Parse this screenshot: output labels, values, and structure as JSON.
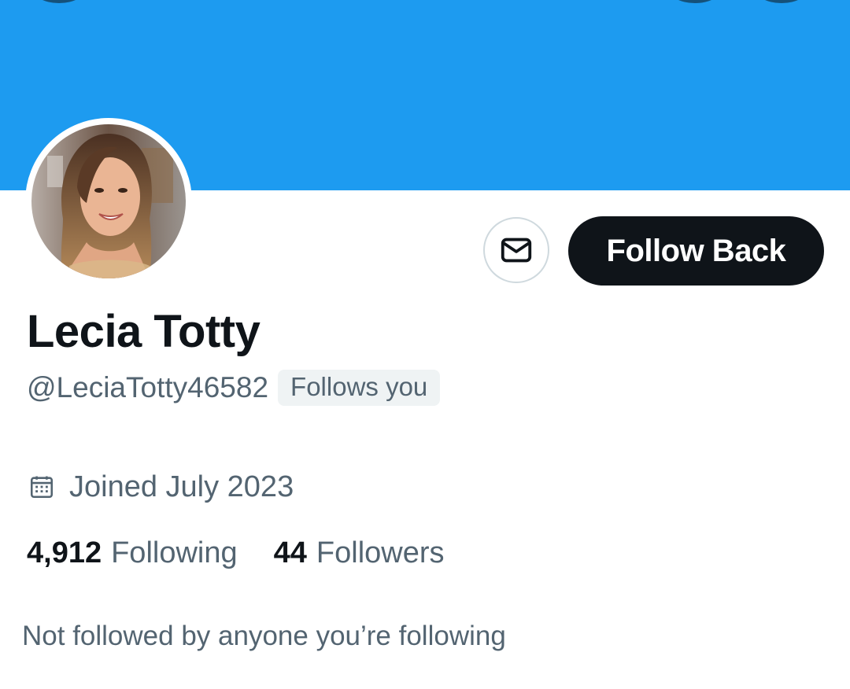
{
  "profile": {
    "display_name": "Lecia Totty",
    "handle": "@LeciaTotty46582",
    "follows_you_badge": "Follows you",
    "joined": "Joined July 2023",
    "following_count": "4,912",
    "following_label": "Following",
    "followers_count": "44",
    "followers_label": "Followers",
    "mutuals_text": "Not followed by anyone you’re following"
  },
  "actions": {
    "follow_back_label": "Follow Back",
    "message_icon": "mail-icon"
  },
  "icons": {
    "joined": "calendar-icon"
  },
  "colors": {
    "banner": "#1d9bf0",
    "primary_text": "#0f1419",
    "secondary_text": "#536471",
    "follow_button_bg": "#0f1419",
    "badge_bg": "#eff3f4",
    "border": "#cfd9de"
  }
}
